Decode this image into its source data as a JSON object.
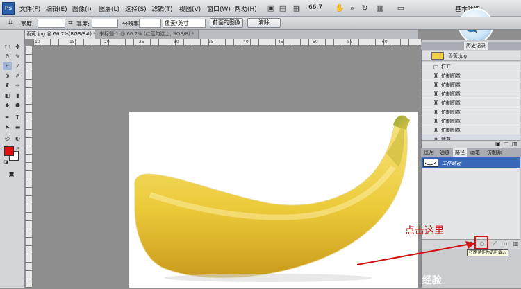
{
  "app": {
    "logo": "Ps",
    "workspace": "基本功能",
    "zoom": "66.7"
  },
  "menu": [
    "文件(F)",
    "编辑(E)",
    "图像(I)",
    "图层(L)",
    "选择(S)",
    "滤镜(T)",
    "视图(V)",
    "窗口(W)",
    "帮助(H)"
  ],
  "options": {
    "width_label": "宽度:",
    "height_label": "高度:",
    "res_label": "分辨率:",
    "units": "像素/英寸",
    "front_image": "前面的图像",
    "clear": "清除"
  },
  "tabs": [
    {
      "label": "香蕉.jpg @ 66.7%(RGB/8#) *"
    },
    {
      "label": "未标题-1 @ 66.7% (红蓝勾选上, RGB/8) *"
    }
  ],
  "ruler": [
    "10",
    "15",
    "20",
    "25",
    "30",
    "35",
    "40",
    "45",
    "50",
    "55",
    "60"
  ],
  "history": {
    "tabs": [
      "历史记录"
    ],
    "snapshot": "香蕉.jpg",
    "items": [
      "打开",
      "仿制图章",
      "仿制图章",
      "仿制图章",
      "仿制图章",
      "仿制图章",
      "仿制图章",
      "仿制图章",
      "裁剪"
    ]
  },
  "paths": {
    "tabs": [
      "图层",
      "通道",
      "路径",
      "画笔",
      "仿制源"
    ],
    "item": "工作路径",
    "tooltip": "将路径作为选区载入"
  },
  "annotation": "点击这里",
  "watermark": "Bai 经验",
  "colors": {
    "foreground": "#e01010",
    "background": "#ffffff",
    "highlight": "#e01010"
  }
}
